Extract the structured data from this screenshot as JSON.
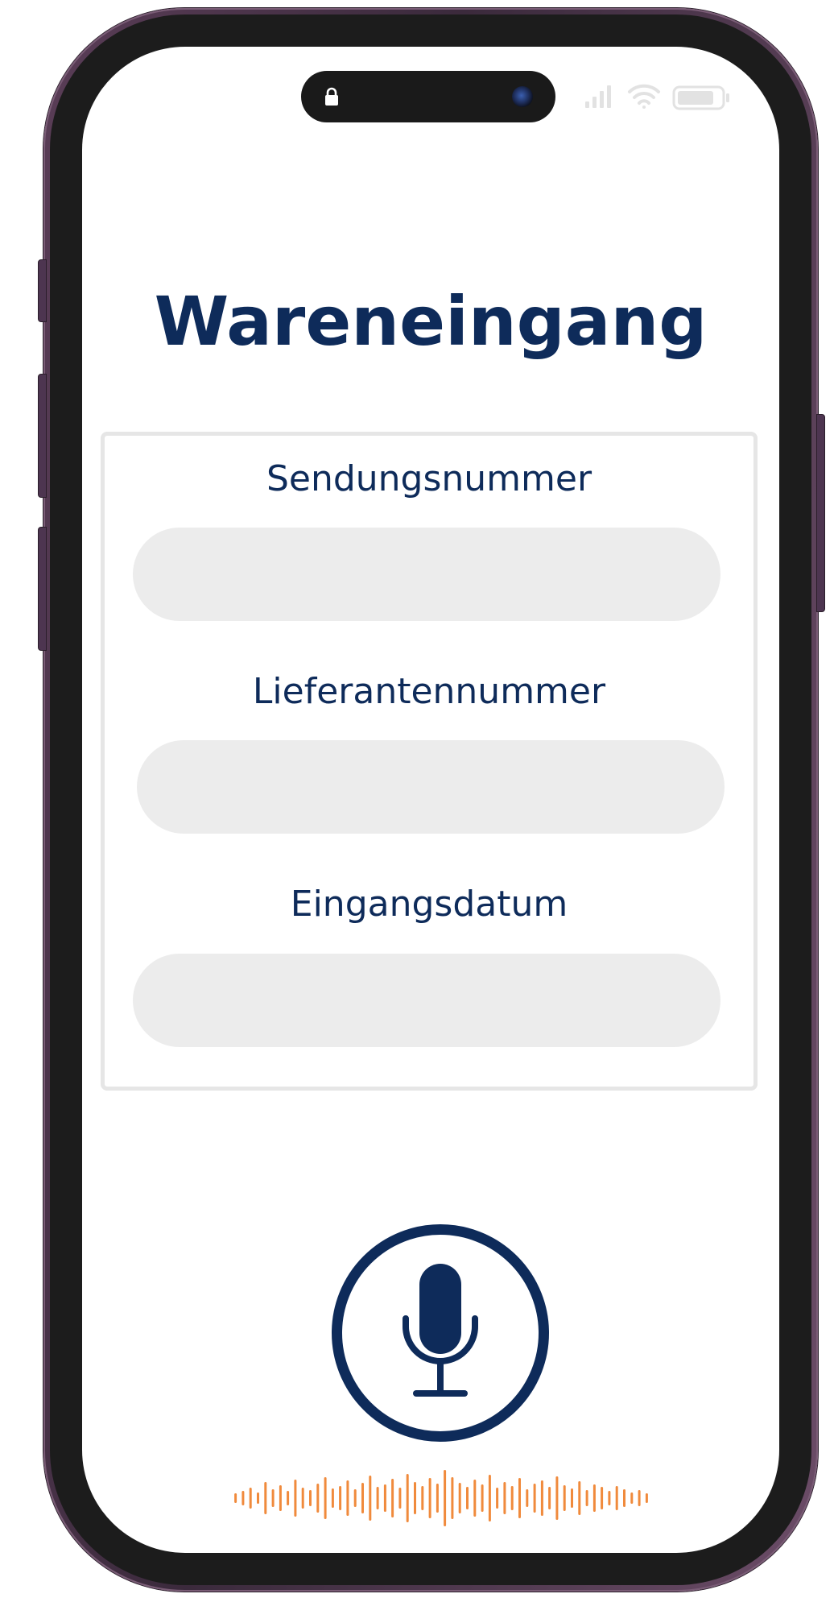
{
  "screen": {
    "title": "Wareneingang",
    "form": {
      "fields": [
        {
          "label": "Sendungsnummer",
          "value": "",
          "placeholder": ""
        },
        {
          "label": "Lieferantennummer",
          "value": "",
          "placeholder": ""
        },
        {
          "label": "Eingangsdatum",
          "value": "",
          "placeholder": ""
        }
      ]
    },
    "voice_input": {
      "icon": "microphone-icon",
      "waveform_icon": "audio-waveform-icon"
    }
  },
  "status_bar": {
    "icons": [
      "lock-icon",
      "camera-icon",
      "signal-icon",
      "wifi-icon",
      "battery-icon"
    ]
  },
  "colors": {
    "primary": "#0e2b5a",
    "input_background": "#ececec",
    "card_border": "#e6e6e6",
    "waveform": "#f08a3c",
    "phone_frame": "#4d3550"
  }
}
